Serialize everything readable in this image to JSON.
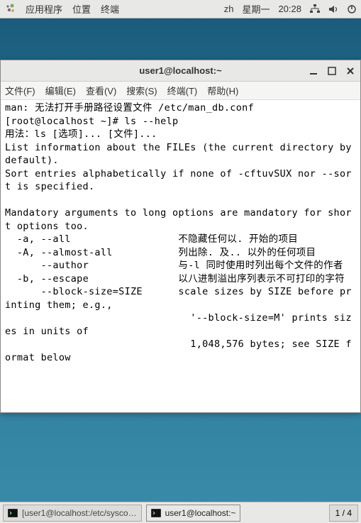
{
  "topbar": {
    "menus": [
      "应用程序",
      "位置",
      "终端"
    ],
    "input_method": "zh",
    "day": "星期一",
    "time": "20:28"
  },
  "window": {
    "title": "user1@localhost:~",
    "menubar": [
      "文件(F)",
      "编辑(E)",
      "查看(V)",
      "搜索(S)",
      "终端(T)",
      "帮助(H)"
    ]
  },
  "terminal": {
    "lines": "man: 无法打开手册路径设置文件 /etc/man_db.conf\n[root@localhost ~]# ls --help\n用法：ls [选项]... [文件]...\nList information about the FILEs (the current directory by default).\nSort entries alphabetically if none of -cftuvSUX nor --sort is specified.\n\nMandatory arguments to long options are mandatory for short options too.\n  -a, --all                  不隐藏任何以. 开始的项目\n  -A, --almost-all           列出除. 及.. 以外的任何项目\n      --author               与-l 同时使用时列出每个文件的作者\n  -b, --escape               以八进制溢出序列表示不可打印的字符\n      --block-size=SIZE      scale sizes by SIZE before printing them; e.g.,\n                               '--block-size=M' prints sizes in units of\n                               1,048,576 bytes; see SIZE format below"
  },
  "taskbar": {
    "tasks": [
      {
        "label": "[user1@localhost:/etc/sysco…",
        "active": false
      },
      {
        "label": "user1@localhost:~",
        "active": true
      }
    ],
    "workspace": "1 / 4"
  }
}
